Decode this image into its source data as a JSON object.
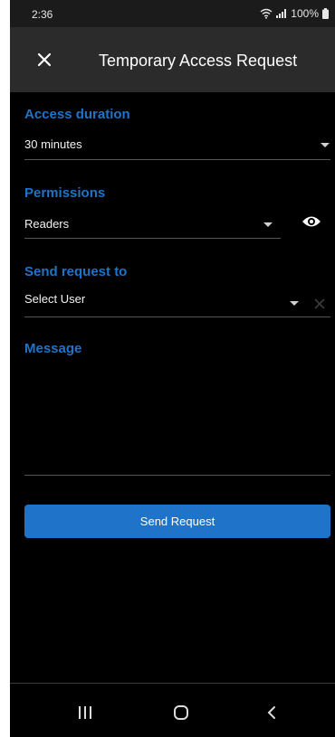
{
  "status_bar": {
    "time": "2:36",
    "battery": "100%"
  },
  "app_bar": {
    "title": "Temporary Access Request",
    "close_icon": "close-icon"
  },
  "access_duration": {
    "label": "Access duration",
    "value": "30 minutes"
  },
  "permissions": {
    "label": "Permissions",
    "value": "Readers",
    "action_icon": "eye-icon"
  },
  "send_request_to": {
    "label": "Send request to",
    "placeholder": "Select User",
    "clear_icon": "clear-icon"
  },
  "message": {
    "label": "Message",
    "value": ""
  },
  "send_button": {
    "label": "Send Request"
  },
  "nav_bar": {
    "recent_icon": "recent-apps-icon",
    "home_icon": "home-icon",
    "back_icon": "back-icon"
  },
  "colors": {
    "accent": "#1f73c9",
    "background": "#000000",
    "app_bar": "#2b2b2b"
  }
}
